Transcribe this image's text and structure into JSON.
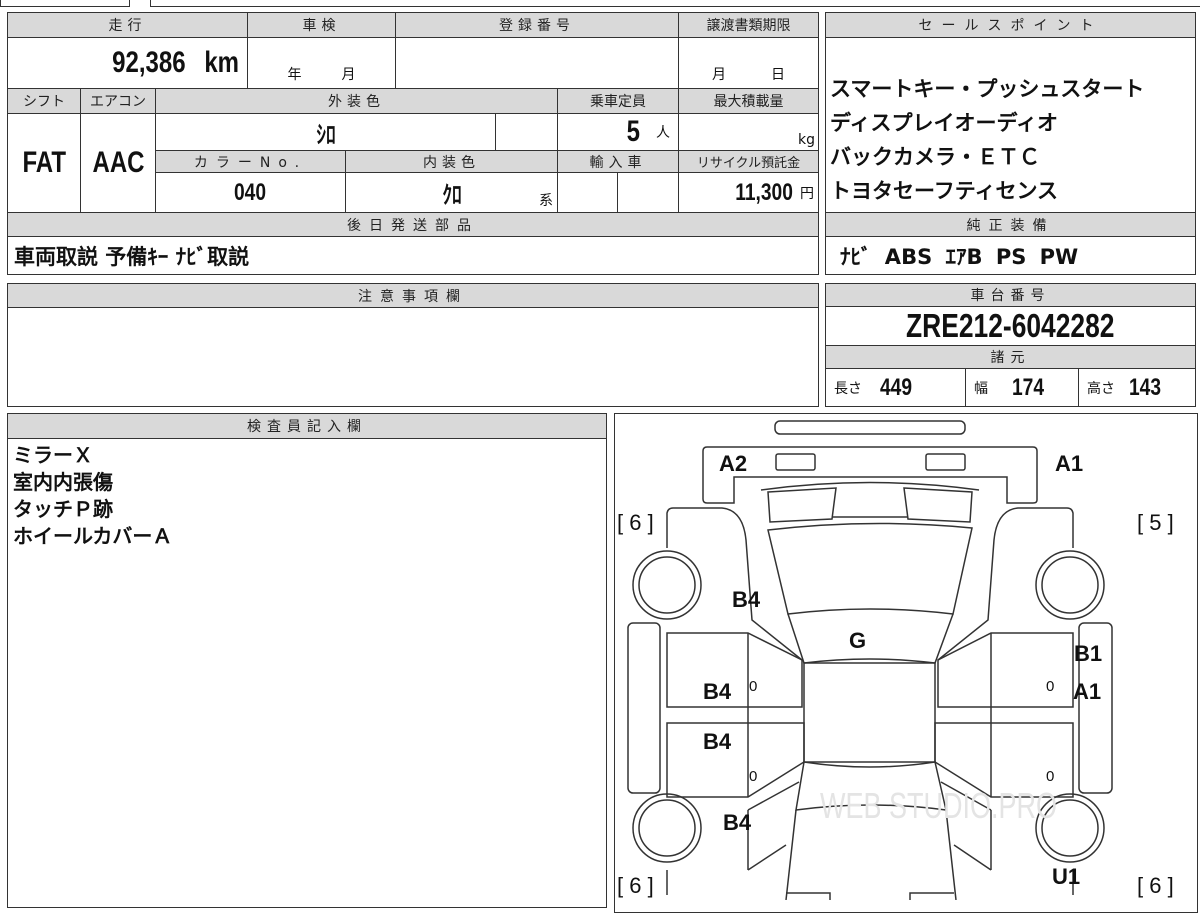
{
  "mileage": {
    "label": "走行",
    "value": "92,386",
    "unit": "km"
  },
  "inspection": {
    "label": "車検",
    "year": "年",
    "month": "月"
  },
  "registration": {
    "label": "登録番号"
  },
  "transfer_deadline": {
    "label": "譲渡書類期限",
    "month": "月",
    "day": "日"
  },
  "shift": {
    "label": "シフト",
    "value": "FAT"
  },
  "aircon": {
    "label": "エアコン",
    "value": "AAC"
  },
  "exterior_color": {
    "label": "外装色",
    "value": "ｼﾛ"
  },
  "capacity": {
    "label": "乗車定員",
    "value": "5",
    "unit": "人"
  },
  "max_load": {
    "label": "最大積載量",
    "unit": "kg"
  },
  "color_no": {
    "label": "カラーNo.",
    "value": "040"
  },
  "interior_color": {
    "label": "内装色",
    "value": "ｸﾛ",
    "suffix": "系"
  },
  "import": {
    "label": "輸入車"
  },
  "recycle": {
    "label": "リサイクル預託金",
    "value": "11,300",
    "unit": "円"
  },
  "later_parts": {
    "label": "後日発送部品",
    "value": "車両取説 予備ｷｰ ﾅﾋﾞ取説"
  },
  "sales_points": {
    "label": "セールスポイント",
    "items": [
      "スマートキー・プッシュスタート",
      "ディスプレイオーディオ",
      "バックカメラ・ＥＴＣ",
      "トヨタセーフティセンス"
    ]
  },
  "equipment": {
    "label": "純正装備",
    "value": "ﾅﾋﾞ ABS ｴｱB PS PW"
  },
  "notes": {
    "label": "注意事項欄"
  },
  "chassis": {
    "label": "車台番号",
    "value": "ZRE212-6042282"
  },
  "specs": {
    "label": "諸元",
    "length_label": "長さ",
    "length": "449",
    "width_label": "幅",
    "width": "174",
    "height_label": "高さ",
    "height": "143"
  },
  "inspector": {
    "label": "検査員記入欄",
    "lines": [
      "ミラーＸ",
      "室内内張傷",
      "タッチＰ跡",
      "ホイールカバーＡ"
    ]
  },
  "diagram": {
    "marks": [
      "A2",
      "A1",
      "B4",
      "G",
      "B1",
      "B4",
      "A1",
      "B4",
      "B4",
      "U1"
    ],
    "tires": [
      "[ 6 ]",
      "[ 5 ]",
      "[ 6 ]",
      "[ 6 ]"
    ],
    "zeros": [
      "0",
      "0",
      "0",
      "0"
    ],
    "watermark": "WEB STUDIO.PRO"
  }
}
